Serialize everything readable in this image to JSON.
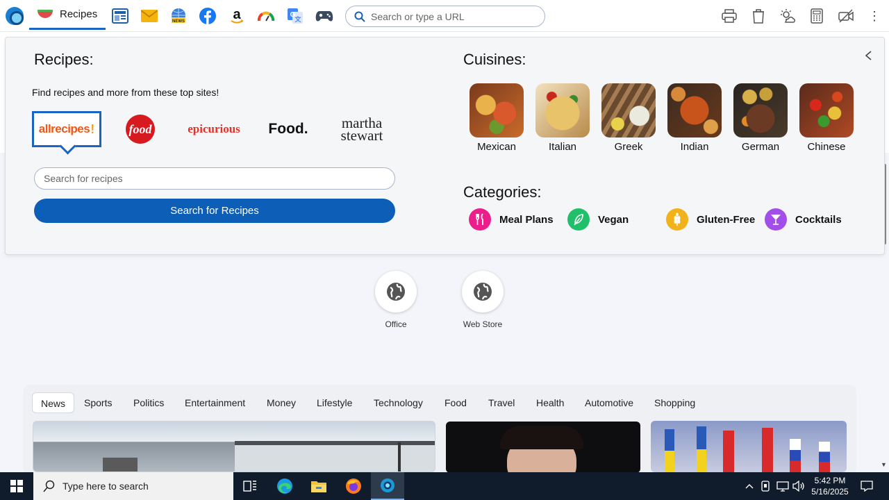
{
  "browser": {
    "active_tab_label": "Recipes",
    "url_placeholder": "Search or type a URL"
  },
  "recipes_panel": {
    "title": "Recipes:",
    "subtitle": "Find recipes and more from these top sites!",
    "sites": [
      {
        "name": "allrecipes",
        "color": "#e85a1b"
      },
      {
        "name": "food",
        "color": "#d71920"
      },
      {
        "name": "epicurious",
        "color": "#e4322b"
      },
      {
        "name": "Food.",
        "color": "#111111"
      },
      {
        "name": "martha stewart",
        "color": "#222222"
      }
    ],
    "search_placeholder": "Search for recipes",
    "search_button": "Search for Recipes",
    "cuisines_title": "Cuisines:",
    "cuisines": [
      {
        "name": "Mexican",
        "color": "#c96b2b"
      },
      {
        "name": "Italian",
        "color": "#d8a24a"
      },
      {
        "name": "Greek",
        "color": "#8a6a4a"
      },
      {
        "name": "Indian",
        "color": "#a4461c"
      },
      {
        "name": "German",
        "color": "#5a3a24"
      },
      {
        "name": "Chinese",
        "color": "#c04a24"
      }
    ],
    "categories_title": "Categories:",
    "categories": [
      {
        "name": "Meal Plans",
        "icon": "utensils-icon",
        "color": "#ec1e8c"
      },
      {
        "name": "Vegan",
        "icon": "leaf-icon",
        "color": "#20c06b"
      },
      {
        "name": "Gluten-Free",
        "icon": "wheat-icon",
        "color": "#f2b21c"
      },
      {
        "name": "Cocktails",
        "icon": "cocktail-icon",
        "color": "#a24ee8"
      }
    ]
  },
  "shortcuts": [
    {
      "label": "Office"
    },
    {
      "label": "Web Store"
    }
  ],
  "news": {
    "tabs": [
      "News",
      "Sports",
      "Politics",
      "Entertainment",
      "Money",
      "Lifestyle",
      "Technology",
      "Food",
      "Travel",
      "Health",
      "Automotive",
      "Shopping"
    ],
    "active_tab": "News"
  },
  "taskbar": {
    "search_placeholder": "Type here to search",
    "time": "5:42 PM",
    "date": "5/16/2025"
  }
}
